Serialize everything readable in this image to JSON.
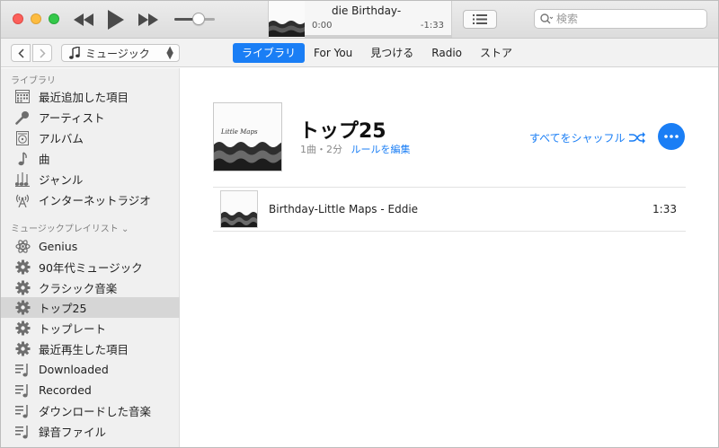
{
  "player": {
    "now_playing": "die   Birthday-",
    "elapsed": "0:00",
    "remaining": "-1:33",
    "progress": 0.0,
    "volume": 0.6
  },
  "search": {
    "placeholder": "検索"
  },
  "nav": {
    "media_kind": "ミュージック",
    "tabs": [
      {
        "label": "ライブラリ",
        "active": true
      },
      {
        "label": "For You",
        "active": false
      },
      {
        "label": "見つける",
        "active": false
      },
      {
        "label": "Radio",
        "active": false
      },
      {
        "label": "ストア",
        "active": false
      }
    ]
  },
  "sidebar": {
    "library_header": "ライブラリ",
    "library_items": [
      {
        "label": "最近追加した項目",
        "icon": "calendar-grid-icon"
      },
      {
        "label": "アーティスト",
        "icon": "microphone-icon"
      },
      {
        "label": "アルバム",
        "icon": "album-icon"
      },
      {
        "label": "曲",
        "icon": "music-note-icon"
      },
      {
        "label": "ジャンル",
        "icon": "genre-icon"
      },
      {
        "label": "インターネットラジオ",
        "icon": "radio-antenna-icon"
      }
    ],
    "playlists_header": "ミュージックプレイリスト",
    "playlist_items": [
      {
        "label": "Genius",
        "icon": "genius-atom-icon",
        "selected": false
      },
      {
        "label": "90年代ミュージック",
        "icon": "smart-playlist-gear-icon",
        "selected": false
      },
      {
        "label": "クラシック音楽",
        "icon": "smart-playlist-gear-icon",
        "selected": false
      },
      {
        "label": "トップ25",
        "icon": "smart-playlist-gear-icon",
        "selected": true
      },
      {
        "label": "トップレート",
        "icon": "smart-playlist-gear-icon",
        "selected": false
      },
      {
        "label": "最近再生した項目",
        "icon": "smart-playlist-gear-icon",
        "selected": false
      },
      {
        "label": "Downloaded",
        "icon": "playlist-icon",
        "selected": false
      },
      {
        "label": "Recorded",
        "icon": "playlist-icon",
        "selected": false
      },
      {
        "label": "ダウンロードした音楽",
        "icon": "playlist-icon",
        "selected": false
      },
      {
        "label": "録音ファイル",
        "icon": "playlist-icon",
        "selected": false
      }
    ]
  },
  "playlist": {
    "title": "トップ25",
    "meta": "1曲・2分",
    "edit_rules": "ルールを編集",
    "shuffle_all": "すべてをシャッフル",
    "artwork_text": "Little Maps",
    "tracks": [
      {
        "name": "Birthday-Little Maps - Eddie",
        "duration": "1:33"
      }
    ]
  },
  "colors": {
    "accent": "#1a7ef5",
    "sidebar_bg": "#f0f0f0",
    "selected_bg": "#d6d6d6"
  }
}
